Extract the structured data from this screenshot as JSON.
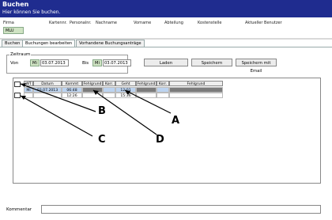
{
  "header": {
    "title": "Buchen",
    "subtitle": "Hier können Sie buchen."
  },
  "columns": [
    "Firma",
    "Kartennr.",
    "Personalnr.",
    "Nachname",
    "Vorname",
    "Abteilung",
    "Kostenstelle",
    "Aktueller Benutzer"
  ],
  "firma_value": "MLU",
  "tabs": [
    "Buchen",
    "Buchungen bearbeiten",
    "Vorhandene Buchungsanträge"
  ],
  "zeitraum": {
    "label": "Zeitraum",
    "von_label": "Von",
    "von_day": "Mi",
    "von_date": "03.07.2013",
    "bis_label": "Bis",
    "bis_day": "Mi",
    "bis_date": "03.07.2013"
  },
  "buttons": {
    "laden": "Laden",
    "speichern": "Speichern",
    "speichern_email": "Speichern mit Email"
  },
  "grid": {
    "headers": [
      "WT",
      "Datum",
      "Kommt",
      "Fehlgrund",
      "Korr.",
      "Geht",
      "Fehlgrund",
      "Korr.",
      "Fehlgrund"
    ],
    "rows": [
      {
        "wt": "Mi",
        "datum": "03.07.2013",
        "kommt": "06:48",
        "geht": "12:01"
      },
      {
        "wt": "",
        "datum": "",
        "kommt": "12:26",
        "geht": "15:36"
      }
    ]
  },
  "callouts": [
    "A",
    "B",
    "C",
    "D"
  ],
  "kommentar_label": "Kommentar",
  "colors": {
    "header_bg": "#1f2c8f",
    "accent_green": "#cfe3c3",
    "selection": "#bcd3f0",
    "dark_cell": "#7b7b7b"
  }
}
